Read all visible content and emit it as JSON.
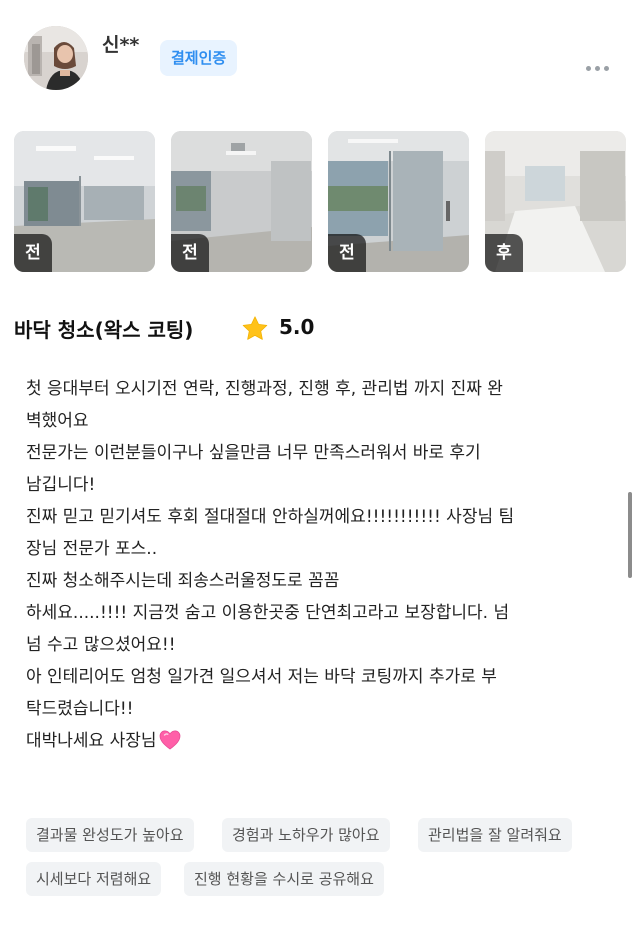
{
  "reviewer": {
    "name": "신**",
    "badge": "결제인증"
  },
  "photos": [
    {
      "tag": "전"
    },
    {
      "tag": "전"
    },
    {
      "tag": "전"
    },
    {
      "tag": "후"
    }
  ],
  "service": {
    "title": "바닥 청소(왁스 코팅)",
    "rating": "5.0"
  },
  "review_lines": [
    "첫 응대부터 오시기전 연락, 진행과정, 진행 후, 관리법 까지 진짜 완",
    "벽했어요",
    "전문가는 이런분들이구나 싶을만큼 너무 만족스러워서 바로 후기",
    "남깁니다!",
    "진짜 믿고 믿기셔도 후회 절대절대 안하실꺼에요!!!!!!!!!!! 사장님 팀",
    "장님 전문가 포스..",
    "진짜 청소해주시는데 죄송스러울정도로 꼼꼼",
    "하세요.....!!!! 지금껏 숨고 이용한곳중 단연최고라고 보장합니다. 넘",
    "넘 수고 많으셨어요!!",
    "아 인테리어도 엄청 일가견 일으셔서 저는 바닥 코팅까지 추가로 부",
    "탁드렸습니다!!",
    "대박나세요 사장님"
  ],
  "keywords": [
    "결과물 완성도가 높아요",
    "경험과 노하우가 많아요",
    "관리법을 잘 알려줘요",
    "시세보다 저렴해요",
    "진행 현황을 수시로 공유해요"
  ],
  "icons": {
    "more": "more-dots-icon",
    "star": "star-icon",
    "heart": "pink-heart-icon"
  },
  "colors": {
    "badge_bg": "#e8f3ff",
    "badge_text": "#2f8ef0",
    "star": "#ffc21a",
    "chip_bg": "#f1f3f5"
  }
}
